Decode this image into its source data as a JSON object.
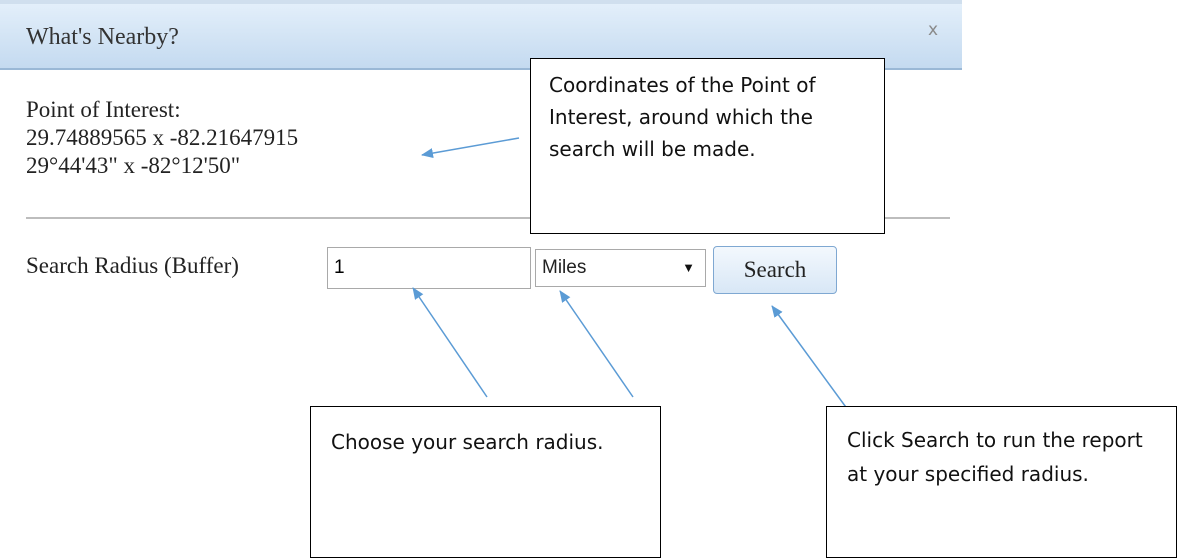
{
  "dialog": {
    "title": "What's Nearby?",
    "close_label": "x"
  },
  "poi": {
    "label": "Point of Interest:",
    "decimal": "29.74889565 x -82.21647915",
    "dms": "29°44'43\" x -82°12'50\""
  },
  "search": {
    "label": "Search Radius (Buffer)",
    "radius_value": "1",
    "unit_selected": "Miles",
    "button_label": "Search"
  },
  "callouts": {
    "coords": "Coordinates of the Point of Interest, around which the search will be made.",
    "radius": "Choose your search radius.",
    "search": "Click Search to run the report at your specified radius."
  },
  "colors": {
    "titlebar": "#c4daf0",
    "arrow": "#5b9bd5",
    "button_border": "#7fa8d2"
  }
}
